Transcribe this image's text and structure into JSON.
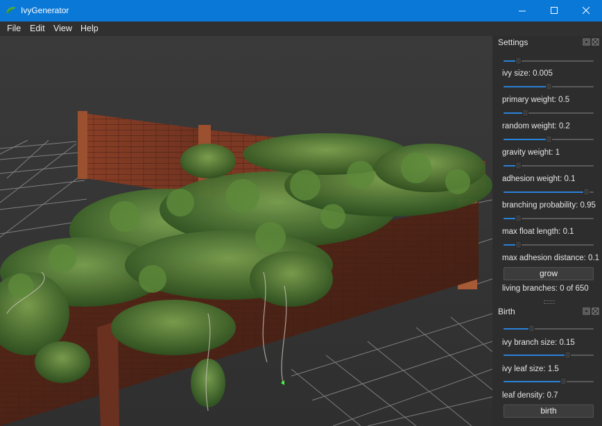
{
  "window": {
    "title": "IvyGenerator"
  },
  "menu": [
    {
      "label": "File"
    },
    {
      "label": "Edit"
    },
    {
      "label": "View"
    },
    {
      "label": "Help"
    }
  ],
  "settings": {
    "title": "Settings",
    "sliders": [
      {
        "label": "ivy size: 0.005",
        "level": 0.14
      },
      {
        "label": "primary weight: 0.5",
        "level": 0.5
      },
      {
        "label": "random weight: 0.2",
        "level": 0.22
      },
      {
        "label": "gravity weight: 1",
        "level": 0.5
      },
      {
        "label": "adhesion weight: 0.1",
        "level": 0.14
      },
      {
        "label": "branching probability: 0.95",
        "level": 0.95
      },
      {
        "label": "max float length: 0.1",
        "level": 0.14
      },
      {
        "label": "max adhesion distance: 0.1",
        "level": 0.14
      }
    ],
    "grow_button": "grow",
    "status": "living branches: 0 of 650"
  },
  "birth": {
    "title": "Birth",
    "sliders": [
      {
        "label": "ivy branch size: 0.15",
        "level": 0.3
      },
      {
        "label": "ivy leaf size: 1.5",
        "level": 0.73
      },
      {
        "label": "leaf density: 0.7",
        "level": 0.68
      }
    ],
    "birth_button": "birth"
  },
  "colors": {
    "titlebar": "#0a78d7",
    "accent": "#2a82da",
    "wall": "#7a3a22",
    "ivy": "#3f6a2c"
  }
}
